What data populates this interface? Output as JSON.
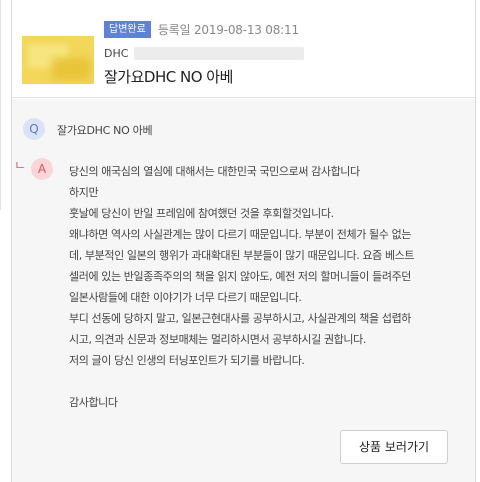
{
  "product": {
    "status_badge": "답변완료",
    "reg_date": "등록일 2019-08-13 08:11",
    "brand": "DHC",
    "name": "잘가요DHC NO 아베"
  },
  "question": {
    "icon": "Q",
    "text": "잘가요DHC NO 아베"
  },
  "answer": {
    "icon": "A",
    "lines": [
      "당신의 애국심의 열심에 대해서는 대한민국 국민으로써 감사합니다",
      "하지만",
      "훗날에 당신이 반일 프레임에 참여했던 것을 후회할것입니다.",
      "왜냐하면 역사의 사실관계는 많이 다르기 때문입니다. 부분이 전체가 될수 없는",
      "데, 부분적인 일본의 행위가 과대확대된 부분들이 많기 때문입니다. 요즘 베스트",
      "셀러에 있는 반일종족주의의 책을 읽지 않아도, 예전 저의 할머니들이 들려주던",
      "일본사람들에 대한 이야기가 너무 다르기 때문입니다.",
      "부디 선동에 당하지 말고, 일본근현대사를 공부하시고, 사실관계의 책을 섭렵하",
      "시고, 의견과 신문과 정보매체는 멀리하시면서 공부하시길 권합니다.",
      "저의 글이 당신 인생의 터닝포인트가 되기를 바랍니다."
    ],
    "closing": "감사합니다"
  },
  "go_button": "상품 보러가기"
}
